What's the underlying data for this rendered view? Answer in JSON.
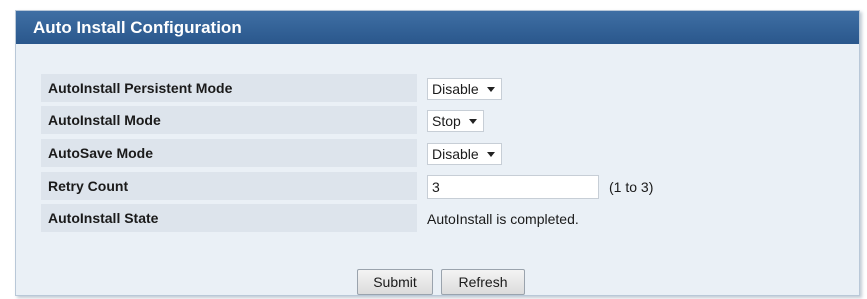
{
  "panel": {
    "title": "Auto Install Configuration"
  },
  "rows": [
    {
      "label": "AutoInstall Persistent Mode",
      "value": "Disable"
    },
    {
      "label": "AutoInstall Mode",
      "value": "Stop"
    },
    {
      "label": "AutoSave Mode",
      "value": "Disable"
    },
    {
      "label": "Retry Count",
      "value": "3",
      "hint": "(1 to 3)"
    },
    {
      "label": "AutoInstall State",
      "value": "AutoInstall is completed."
    }
  ],
  "buttons": {
    "submit": "Submit",
    "refresh": "Refresh"
  },
  "icons": {
    "dropdown": "chevron-down-icon"
  },
  "colors": {
    "header": "#2f5f96",
    "panel": "#eaf0f6",
    "label_cell": "#dde4ec"
  }
}
